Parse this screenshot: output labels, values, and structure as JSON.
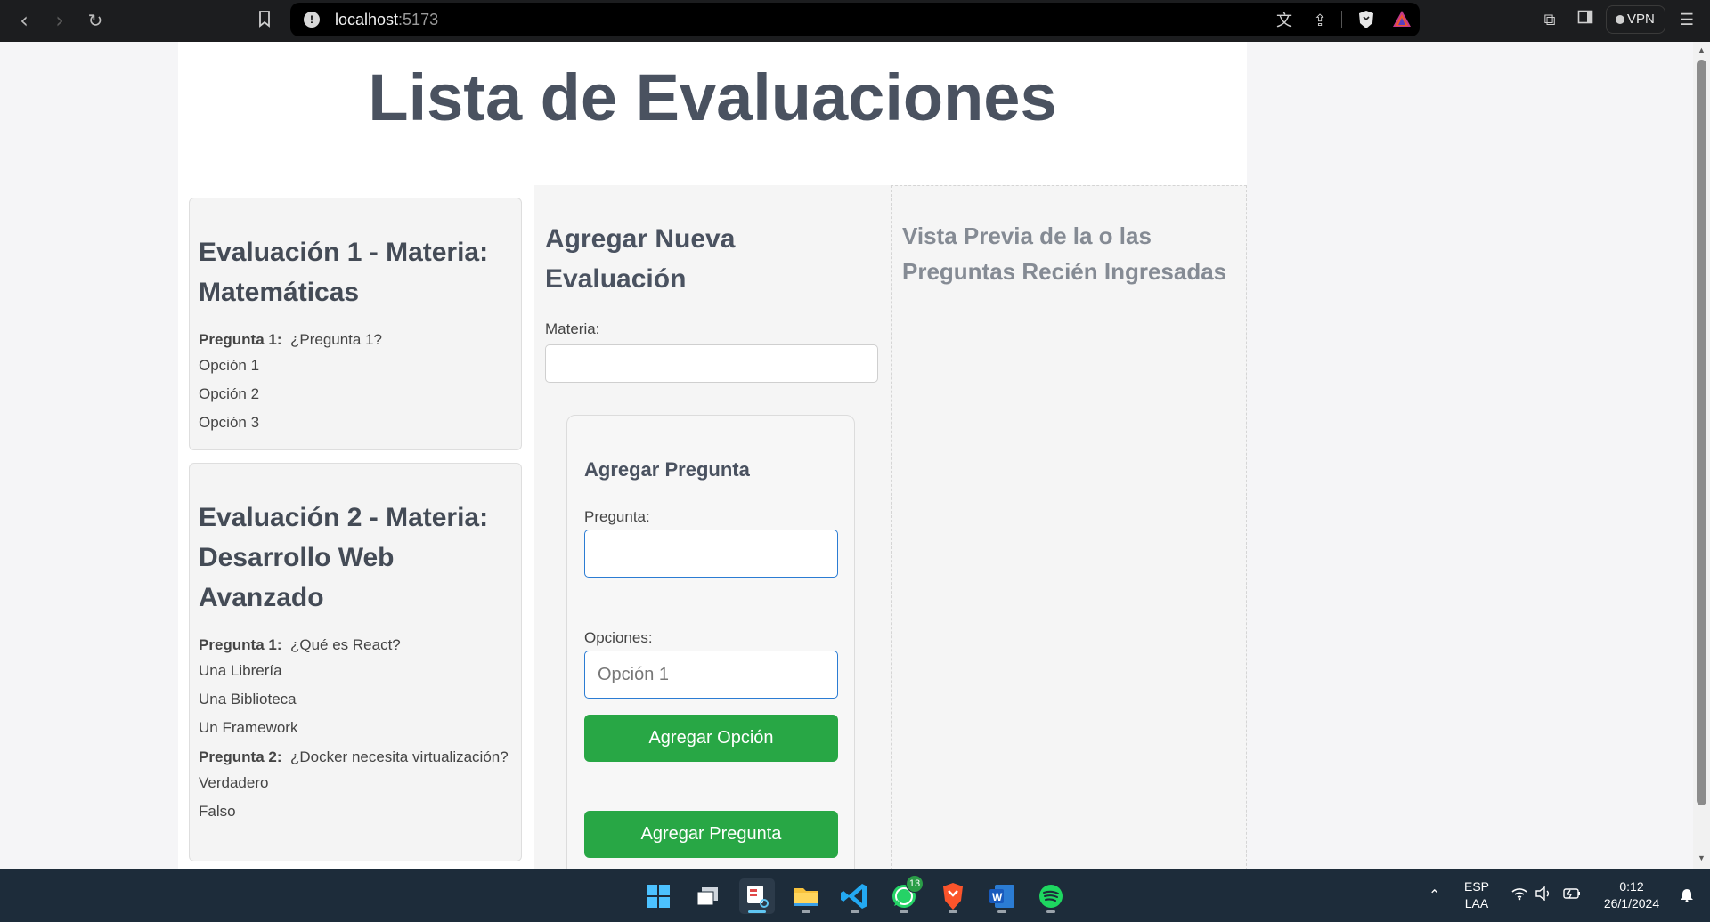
{
  "browser": {
    "url_host": "localhost",
    "url_port": ":5173",
    "vpn_label": "VPN"
  },
  "page": {
    "title": "Lista de Evaluaciones"
  },
  "evaluations": [
    {
      "title": "Evaluación 1 - Materia: Matemáticas",
      "questions": [
        {
          "label": "Pregunta 1:",
          "text": "¿Pregunta 1?",
          "options": [
            "Opción 1",
            "Opción 2",
            "Opción 3"
          ]
        }
      ]
    },
    {
      "title": "Evaluación 2 - Materia: Desarrollo Web Avanzado",
      "questions": [
        {
          "label": "Pregunta 1:",
          "text": "¿Qué es React?",
          "options": [
            "Una Librería",
            "Una Biblioteca",
            "Un Framework"
          ]
        },
        {
          "label": "Pregunta 2:",
          "text": "¿Docker necesita virtualización?",
          "options": [
            "Verdadero",
            "Falso"
          ]
        }
      ]
    }
  ],
  "form": {
    "title": "Agregar Nueva Evaluación",
    "materia_label": "Materia:",
    "materia_value": "",
    "question_card": {
      "title": "Agregar Pregunta",
      "pregunta_label": "Pregunta:",
      "pregunta_value": "",
      "opciones_label": "Opciones:",
      "option_placeholder": "Opción 1",
      "add_option_button": "Agregar Opción",
      "add_question_button": "Agregar Pregunta"
    }
  },
  "preview": {
    "title": "Vista Previa de la o las Preguntas Recién Ingresadas"
  },
  "taskbar": {
    "whatsapp_badge": "13",
    "language": "ESP",
    "keyboard": "LAA",
    "time": "0:12",
    "date": "26/1/2024"
  },
  "colors": {
    "accent_green": "#28a745",
    "title_gray": "#4a5260",
    "focus_blue": "#2b7cd3",
    "taskbar_bg": "#1d2c3a"
  }
}
